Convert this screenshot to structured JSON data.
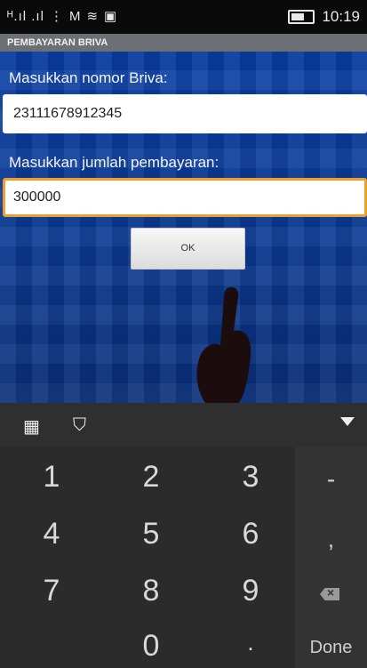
{
  "status_bar": {
    "signal_text": "ᴴ.ıl .ıl",
    "time": "10:19"
  },
  "app": {
    "title": "PEMBAYARAN BRIVA"
  },
  "form": {
    "briva_label": "Masukkan nomor Briva:",
    "briva_value": "23111678912345",
    "amount_label": "Masukkan jumlah pembayaran:",
    "amount_value": "300000",
    "ok_label": "OK"
  },
  "keyboard": {
    "keys": [
      "1",
      "2",
      "3",
      "4",
      "5",
      "6",
      "7",
      "8",
      "9",
      "0"
    ],
    "minus": "-",
    "comma": ",",
    "dot": ".",
    "done": "Done"
  },
  "colors": {
    "accent_border": "#f29c2e",
    "background": "#0b3a93"
  }
}
